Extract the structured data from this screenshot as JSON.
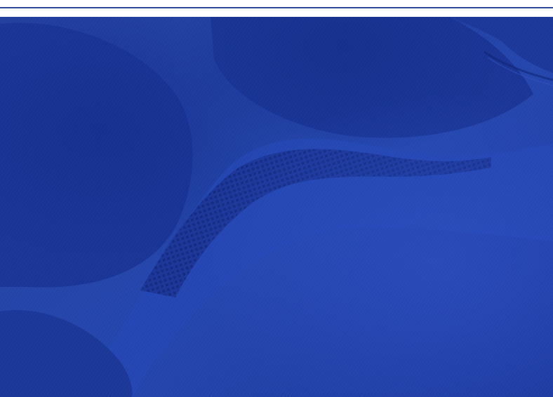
{
  "image": {
    "subject": "blue-knit-fabric-closeup",
    "colors": {
      "base": "#1f3aa5",
      "dark": "#132a84",
      "light": "#2d4ec0",
      "mesh": "#172f8f",
      "background": "#ffffff"
    }
  }
}
